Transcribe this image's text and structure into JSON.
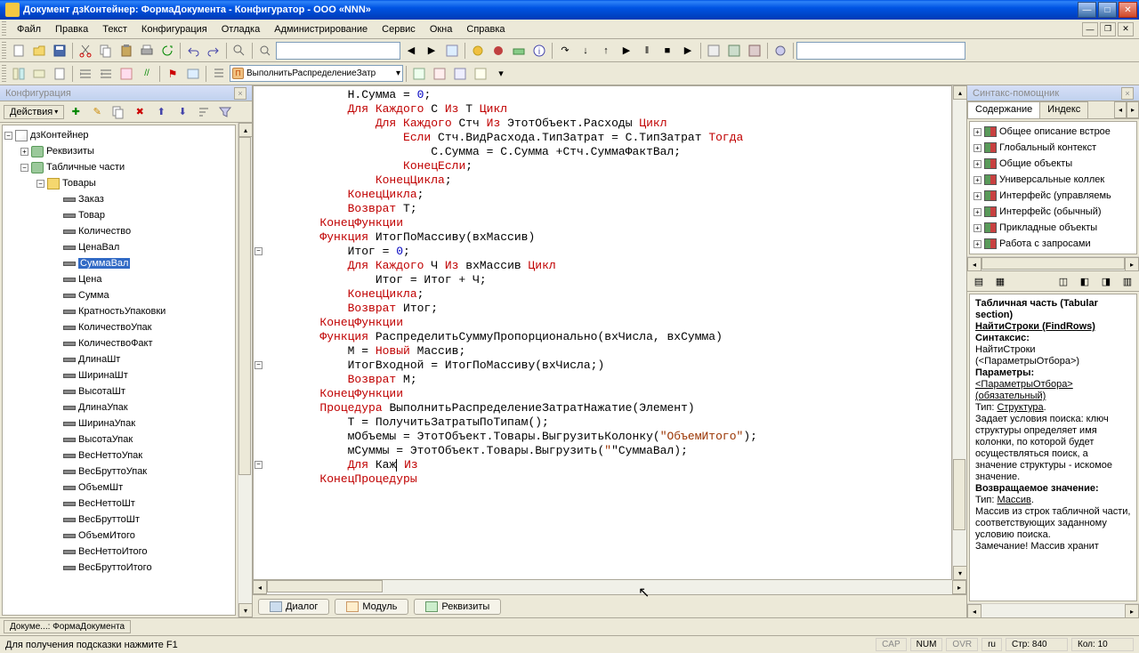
{
  "title": "Документ дзКонтейнер: ФормаДокумента - Конфигуратор - ООО «NNN»",
  "menu": [
    "Файл",
    "Правка",
    "Текст",
    "Конфигурация",
    "Отладка",
    "Администрирование",
    "Сервис",
    "Окна",
    "Справка"
  ],
  "combo_proc": "ВыполнитьРаспределениеЗатр",
  "left_title": "Конфигурация",
  "actions_label": "Действия",
  "tree_root": "дзКонтейнер",
  "tree_l1": [
    "Реквизиты",
    "Табличные части"
  ],
  "tree_l2": "Товары",
  "tree_fields": [
    "Заказ",
    "Товар",
    "Количество",
    "ЦенаВал",
    "СуммаВал",
    "Цена",
    "Сумма",
    "КратностьУпаковки",
    "КоличествоУпак",
    "КоличествоФакт",
    "ДлинаШт",
    "ШиринаШт",
    "ВысотаШт",
    "ДлинаУпак",
    "ШиринаУпак",
    "ВысотаУпак",
    "ВесНеттоУпак",
    "ВесБруттоУпак",
    "ОбъемШт",
    "ВесНеттоШт",
    "ВесБруттоШт",
    "ОбъемИтого",
    "ВесНеттоИтого",
    "ВесБруттоИтого"
  ],
  "tree_selected_index": 4,
  "bottom_tabs": [
    "Диалог",
    "Модуль",
    "Реквизиты"
  ],
  "right_title_dim": "Синтакс-помощник",
  "right_tabs": [
    "Содержание",
    "Индекс"
  ],
  "help_tree": [
    "Общее описание встрое",
    "Глобальный контекст",
    "Общие объекты",
    "Универсальные коллек",
    "Интерфейс (управляемь",
    "Интерфейс (обычный)",
    "Прикладные объекты",
    "Работа с запросами"
  ],
  "help": {
    "h1": "Табличная часть (Tabular section)",
    "h2": "НайтиСтроки (FindRows)",
    "syntax_lbl": "Синтаксис:",
    "syntax": "НайтиСтроки (<ПараметрыОтбора>)",
    "params_lbl": "Параметры:",
    "param": "<ПараметрыОтбора> (обязательный)",
    "type_lbl": "Тип: ",
    "type_link": "Структура",
    "desc": "Задает условия поиска: ключ структуры определяет имя колонки, по которой будет осуществляться поиск, а значение структуры - искомое значение.",
    "ret_lbl": "Возвращаемое значение:",
    "ret_type": "Массив",
    "ret_desc": "Массив из строк табличной части, соответствующих заданному условию поиска.",
    "note": "Замечание! Массив хранит"
  },
  "doc_tab": "Докуме...: ФормаДокумента",
  "status_hint": "Для получения подсказки нажмите F1",
  "status": {
    "cap": "CAP",
    "num": "NUM",
    "ovr": "OVR",
    "lang": "ru",
    "row_lbl": "Стр: ",
    "row": "840",
    "col_lbl": "Кол: ",
    "col": "10"
  },
  "code": [
    {
      "i": 3,
      "seg": [
        [
          "",
          "Н.Сумма = "
        ],
        [
          "blue",
          "0"
        ],
        [
          "",
          ";"
        ]
      ]
    },
    {
      "i": 3,
      "seg": [
        [
          "red",
          "Для Каждого"
        ],
        [
          "",
          " С "
        ],
        [
          "red",
          "Из"
        ],
        [
          "",
          " Т "
        ],
        [
          "red",
          "Цикл"
        ]
      ]
    },
    {
      "i": 4,
      "seg": [
        [
          "red",
          "Для Каждого"
        ],
        [
          "",
          " Стч "
        ],
        [
          "red",
          "Из"
        ],
        [
          "",
          " ЭтотОбъект.Расходы "
        ],
        [
          "red",
          "Цикл"
        ]
      ]
    },
    {
      "i": 5,
      "seg": [
        [
          "red",
          "Если"
        ],
        [
          "",
          " Стч.ВидРасхода.ТипЗатрат = С.ТипЗатрат "
        ],
        [
          "red",
          "Тогда"
        ]
      ]
    },
    {
      "i": 6,
      "seg": [
        [
          "",
          "С.Сумма = С.Сумма +Стч.СуммаФактВал;"
        ]
      ]
    },
    {
      "i": 5,
      "seg": [
        [
          "red",
          "КонецЕсли"
        ],
        [
          "",
          ";"
        ]
      ]
    },
    {
      "i": 4,
      "seg": [
        [
          "red",
          "КонецЦикла"
        ],
        [
          "",
          ";"
        ]
      ]
    },
    {
      "i": 3,
      "seg": [
        [
          "red",
          "КонецЦикла"
        ],
        [
          "",
          ";"
        ]
      ]
    },
    {
      "i": 3,
      "seg": [
        [
          "red",
          "Возврат"
        ],
        [
          "",
          " Т;"
        ]
      ]
    },
    {
      "i": 2,
      "seg": [
        [
          "red",
          "КонецФункции"
        ]
      ]
    },
    {
      "i": 0,
      "seg": [
        [
          "",
          ""
        ]
      ]
    },
    {
      "i": 2,
      "fold": true,
      "seg": [
        [
          "red",
          "Функция"
        ],
        [
          "",
          " ИтогПоМассиву(вхМассив)"
        ]
      ]
    },
    {
      "i": 3,
      "seg": [
        [
          "",
          "Итог = "
        ],
        [
          "blue",
          "0"
        ],
        [
          "",
          ";"
        ]
      ]
    },
    {
      "i": 3,
      "seg": [
        [
          "red",
          "Для Каждого"
        ],
        [
          "",
          " Ч "
        ],
        [
          "red",
          "Из"
        ],
        [
          "",
          " вхМассив "
        ],
        [
          "red",
          "Цикл"
        ]
      ]
    },
    {
      "i": 4,
      "seg": [
        [
          "",
          "Итог = Итог + Ч;"
        ]
      ]
    },
    {
      "i": 3,
      "seg": [
        [
          "red",
          "КонецЦикла"
        ],
        [
          "",
          ";"
        ]
      ]
    },
    {
      "i": 3,
      "seg": [
        [
          "red",
          "Возврат"
        ],
        [
          "",
          " Итог;"
        ]
      ]
    },
    {
      "i": 2,
      "seg": [
        [
          "red",
          "КонецФункции"
        ]
      ]
    },
    {
      "i": 0,
      "seg": [
        [
          "",
          ""
        ]
      ]
    },
    {
      "i": 2,
      "fold": true,
      "seg": [
        [
          "red",
          "Функция"
        ],
        [
          "",
          " РаспределитьСуммуПропорционально(вхЧисла, вхСумма)"
        ]
      ]
    },
    {
      "i": 3,
      "seg": [
        [
          "",
          "М = "
        ],
        [
          "red",
          "Новый"
        ],
        [
          "",
          " Массив;"
        ]
      ]
    },
    {
      "i": 3,
      "seg": [
        [
          "",
          "ИтогВходной = ИтогПоМассиву(вхЧисла;)"
        ]
      ]
    },
    {
      "i": 0,
      "seg": [
        [
          "",
          ""
        ]
      ]
    },
    {
      "i": 3,
      "seg": [
        [
          "red",
          "Возврат"
        ],
        [
          "",
          " М;"
        ]
      ]
    },
    {
      "i": 2,
      "seg": [
        [
          "red",
          "КонецФункции"
        ]
      ]
    },
    {
      "i": 0,
      "seg": [
        [
          "",
          ""
        ]
      ]
    },
    {
      "i": 2,
      "fold": true,
      "seg": [
        [
          "red",
          "Процедура"
        ],
        [
          "",
          " ВыполнитьРаспределениеЗатратНажатие(Элемент)"
        ]
      ]
    },
    {
      "i": 3,
      "seg": [
        [
          "",
          "Т = ПолучитьЗатратыПоТипам();"
        ]
      ]
    },
    {
      "i": 3,
      "seg": [
        [
          "",
          "мОбъемы = ЭтотОбъект.Товары.ВыгрузитьКолонку("
        ],
        [
          "brown",
          "\"ОбъемИтого\""
        ],
        [
          "",
          ");"
        ]
      ]
    },
    {
      "i": 3,
      "seg": [
        [
          "",
          "мСуммы = ЭтотОбъект.Товары.Выгрузить("
        ],
        [
          "brown",
          "\""
        ],
        [
          "",
          "\"СуммаВал);"
        ]
      ]
    },
    {
      "i": 3,
      "cursor": true,
      "seg": [
        [
          "red",
          "Для"
        ],
        [
          "",
          " Каж"
        ],
        [
          "cur",
          ""
        ],
        [
          "",
          " "
        ],
        [
          "red",
          "Из"
        ]
      ]
    },
    {
      "i": 2,
      "seg": [
        [
          "red",
          "КонецПроцедуры"
        ]
      ]
    }
  ]
}
